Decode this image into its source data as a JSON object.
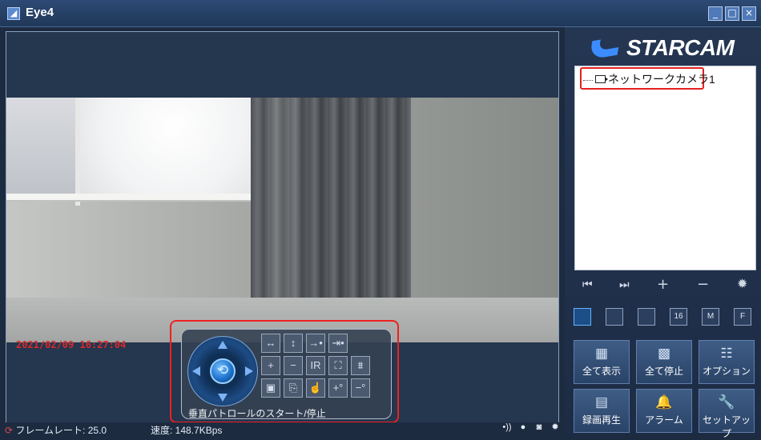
{
  "titlebar": {
    "title": "Eye4",
    "min_glyph": "_",
    "max_glyph": "□",
    "close_glyph": "×"
  },
  "video": {
    "timestamp": "2021/02/09 16:27:04",
    "status": {
      "framerate_icon_glyph": "⟳",
      "framerate_label": "フレームレート: 25.0",
      "speed_label": "速度: 148.7KBps",
      "icons": [
        "speaker-icon",
        "record-dot-icon",
        "camera-icon",
        "settings-icon"
      ],
      "icon_glyphs": [
        "•))",
        "●",
        "◙",
        "✹"
      ]
    }
  },
  "ptz": {
    "caption": "垂直パトロールのスタート/停止",
    "buttons": [
      {
        "name": "horizontal-patrol",
        "glyph": "↔"
      },
      {
        "name": "vertical-patrol",
        "glyph": "↕"
      },
      {
        "name": "patrol-stop",
        "glyph": "→•"
      },
      {
        "name": "patrol-reset",
        "glyph": "⇥•"
      },
      {
        "name": "zoom-in",
        "glyph": "+"
      },
      {
        "name": "zoom-out",
        "glyph": "−"
      },
      {
        "name": "ir-toggle",
        "glyph": "IR"
      },
      {
        "name": "fullscreen",
        "glyph": "⛶"
      },
      {
        "name": "mirror",
        "glyph": "⩩"
      },
      {
        "name": "image-settings",
        "glyph": "▣"
      },
      {
        "name": "lock-preset",
        "glyph": "⎘"
      },
      {
        "name": "touch-lock",
        "glyph": "☝"
      },
      {
        "name": "preset-add",
        "glyph": "+°"
      },
      {
        "name": "preset-remove",
        "glyph": "−°"
      }
    ],
    "center_glyph": "⟲"
  },
  "brand": {
    "logo_text": "STARCAM"
  },
  "device_list": {
    "items": [
      {
        "label": "ネットワークカメラ1"
      }
    ]
  },
  "controls": {
    "first": "⏮",
    "last": "⏭",
    "add": "+",
    "remove": "−",
    "settings": "✹"
  },
  "layouts": [
    {
      "label": ""
    },
    {
      "label": ""
    },
    {
      "label": ""
    },
    {
      "label": "16"
    },
    {
      "label": "M"
    },
    {
      "label": "F"
    }
  ],
  "functions": [
    {
      "label": "全て表示",
      "icon": "▦"
    },
    {
      "label": "全て停止",
      "icon": "▩"
    },
    {
      "label": "オプション",
      "icon": "☷"
    },
    {
      "label": "録画再生",
      "icon": "▤"
    },
    {
      "label": "アラーム",
      "icon": "🔔"
    },
    {
      "label": "セットアップ",
      "icon": "🔧"
    }
  ]
}
